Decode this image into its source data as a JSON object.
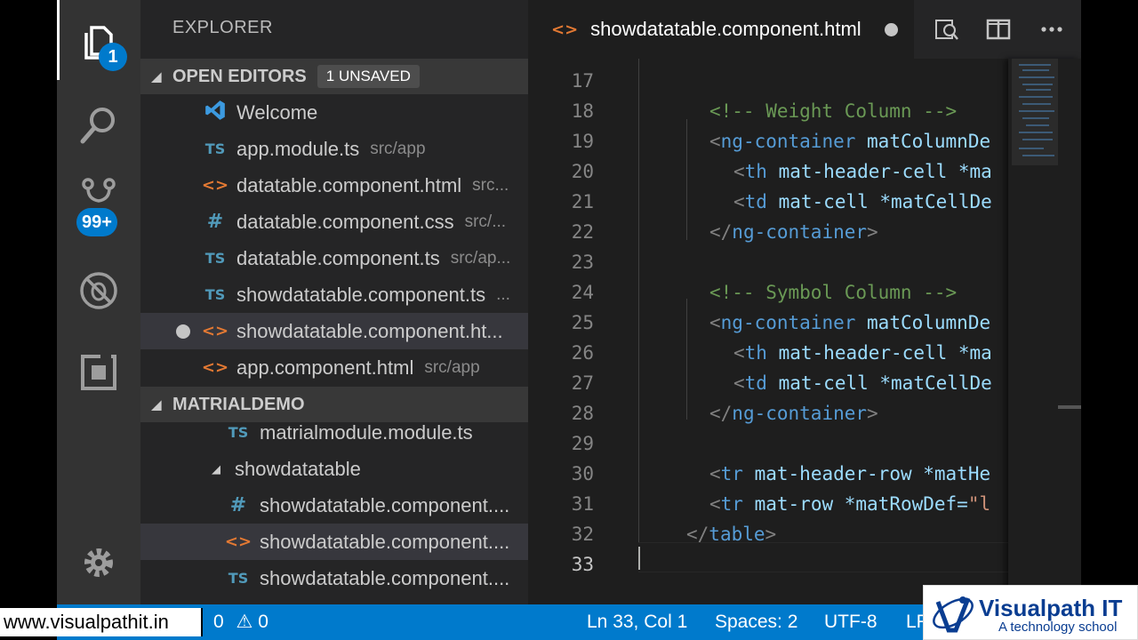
{
  "activity_bar": {
    "explorer_badge": "1",
    "scm_badge": "99+"
  },
  "sidebar": {
    "title": "EXPLORER",
    "open_editors": {
      "label": "OPEN EDITORS",
      "badge": "1 UNSAVED",
      "items": [
        {
          "icon": "vscode-icon",
          "name": "Welcome",
          "desc": ""
        },
        {
          "icon": "ts",
          "name": "app.module.ts",
          "desc": "src/app"
        },
        {
          "icon": "html",
          "name": "datatable.component.html",
          "desc": "src..."
        },
        {
          "icon": "css",
          "name": "datatable.component.css",
          "desc": "src/..."
        },
        {
          "icon": "ts",
          "name": "datatable.component.ts",
          "desc": "src/ap..."
        },
        {
          "icon": "ts",
          "name": "showdatatable.component.ts",
          "desc": "..."
        },
        {
          "icon": "html",
          "name": "showdatatable.component.ht...",
          "desc": ""
        },
        {
          "icon": "html",
          "name": "app.component.html",
          "desc": "src/app"
        }
      ]
    },
    "project": {
      "label": "MATRIALDEMO",
      "items": [
        {
          "icon": "ts",
          "name": "matrialmodule.module.ts"
        },
        {
          "icon": "folder",
          "name": "showdatatable"
        },
        {
          "icon": "css",
          "name": "showdatatable.component...."
        },
        {
          "icon": "html",
          "name": "showdatatable.component...."
        },
        {
          "icon": "ts",
          "name": "showdatatable.component...."
        }
      ]
    }
  },
  "icons": {
    "ts": "TS",
    "html": "<>",
    "css": "#"
  },
  "editor": {
    "tab_title": "showdatatable.component.html",
    "lines": [
      {
        "n": "17"
      },
      {
        "n": "18"
      },
      {
        "n": "19"
      },
      {
        "n": "20"
      },
      {
        "n": "21"
      },
      {
        "n": "22"
      },
      {
        "n": "23"
      },
      {
        "n": "24"
      },
      {
        "n": "25"
      },
      {
        "n": "26"
      },
      {
        "n": "27"
      },
      {
        "n": "28"
      },
      {
        "n": "29"
      },
      {
        "n": "30"
      },
      {
        "n": "31"
      },
      {
        "n": "32"
      },
      {
        "n": "33"
      }
    ],
    "code": {
      "c18": "<!-- Weight Column -->",
      "c24": "<!-- Symbol Column -->",
      "ng_container_open": "ng-container",
      "matcol": "matColumnDe",
      "th": "th",
      "th_attrs": "mat-header-cell *ma",
      "td": "td",
      "td_attrs": "mat-cell *matCellDe",
      "ng_container_close": "ng-container",
      "tr": "tr",
      "tr30_attrs": "mat-header-row *matHe",
      "tr31_attrs": "mat-row *matRowDef=",
      "tr31_str": "\"l",
      "table_close": "table"
    }
  },
  "status_bar": {
    "errors": "0",
    "warnings": "0",
    "position": "Ln 33, Col 1",
    "spaces": "Spaces: 2",
    "encoding": "UTF-8",
    "eol": "LF"
  },
  "overlay": {
    "url": "www.visualpathit.in",
    "brand_name": "Visualpath IT",
    "brand_tagline": "A technology school"
  },
  "colors": {
    "accent": "#007acc",
    "html_icon": "#e37933",
    "ts_icon": "#519aba",
    "comment": "#6a9955",
    "tag": "#569cd6",
    "attr": "#9cdcfe"
  }
}
